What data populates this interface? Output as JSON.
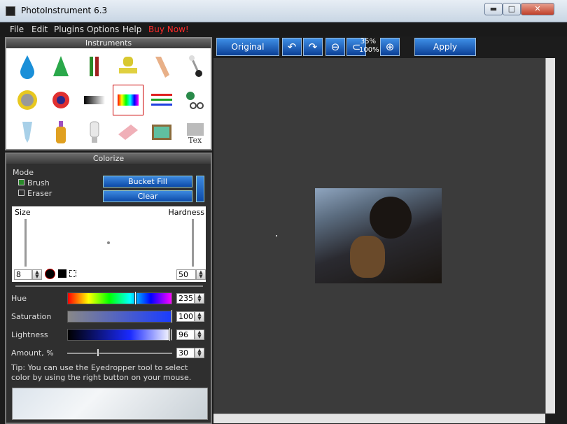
{
  "window": {
    "title": "PhotoInstrument 6.3",
    "min": "▬",
    "max": "□",
    "close": "✕"
  },
  "menu": {
    "items": [
      "File",
      "Edit",
      "Plugins",
      "Options",
      "Help"
    ],
    "buy": "Buy Now!"
  },
  "instruments": {
    "header": "Instruments"
  },
  "colorize": {
    "header": "Colorize",
    "mode_label": "Mode",
    "brush_label": "Brush",
    "eraser_label": "Eraser",
    "bucket_fill": "Bucket Fill",
    "clear": "Clear",
    "size_label": "Size",
    "hardness_label": "Hardness",
    "size_value": "8",
    "hardness_value": "50",
    "hue_label": "Hue",
    "hue_value": "235",
    "saturation_label": "Saturation",
    "saturation_value": "100",
    "lightness_label": "Lightness",
    "lightness_value": "96",
    "amount_label": "Amount, %",
    "amount_value": "30",
    "tip": "Tip: You can use the Eyedropper tool to select color by using the right button on your mouse."
  },
  "toolbar": {
    "original": "Original",
    "apply": "Apply",
    "zoom_top": "35%",
    "zoom_bottom": "100%"
  },
  "colors": {
    "accent": "#0c4aa8",
    "selection": "#cc0000",
    "buy": "#ff2a2a"
  }
}
